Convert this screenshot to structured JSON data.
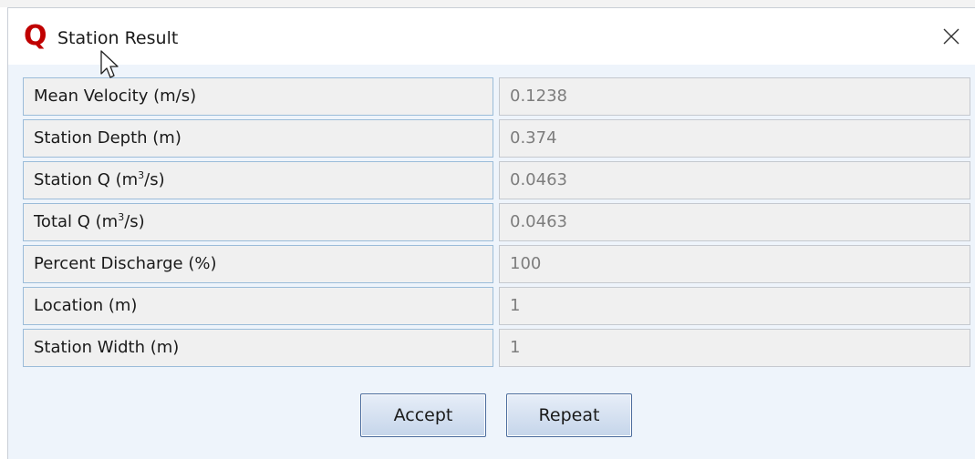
{
  "window": {
    "app_icon_letter": "Q",
    "title": "Station Result",
    "close_glyph": "×",
    "icons": [
      "app-q-icon",
      "close-icon",
      "mouse-pointer-icon"
    ]
  },
  "results": {
    "rows": [
      {
        "label": "Mean Velocity (m/s)",
        "value": "0.1238"
      },
      {
        "label_pre": "Station Q (m",
        "label_sup": "3",
        "label_post": "/s)",
        "value": "0.0463"
      },
      {
        "label": "Station Depth (m)",
        "value": "0.374"
      },
      {
        "label_pre": "Total Q (m",
        "label_sup": "3",
        "label_post": "/s)",
        "value": "0.0463"
      },
      {
        "label": "Percent Discharge (%)",
        "value": "100"
      },
      {
        "label": "Location (m)",
        "value": "1"
      },
      {
        "label": "Station Width (m)",
        "value": "1"
      }
    ]
  },
  "buttons": {
    "accept": "Accept",
    "repeat": "Repeat"
  },
  "colors": {
    "accent_red": "#c00000",
    "dialog_bg": "#eef4fb",
    "cell_border_blue": "#9bbcd9",
    "value_text": "#7d7d7d"
  }
}
